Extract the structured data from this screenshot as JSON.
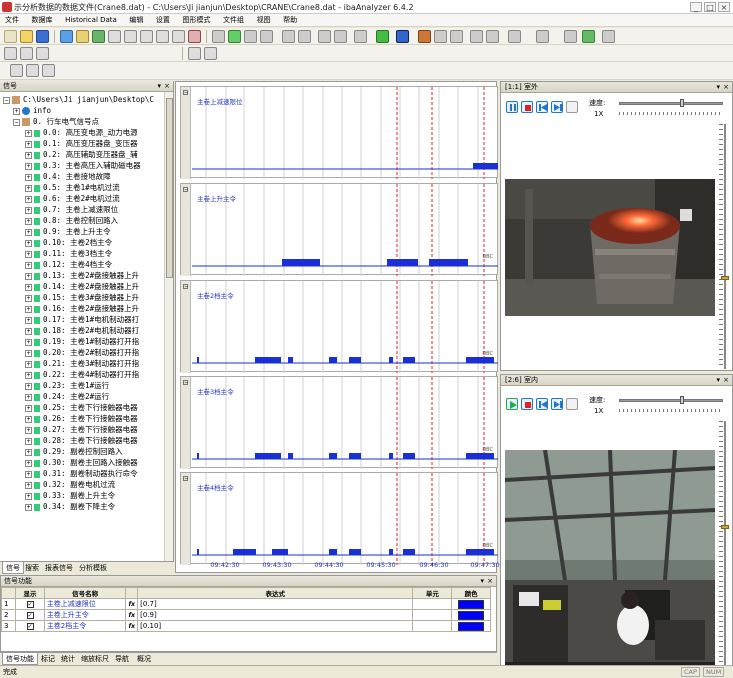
{
  "window": {
    "title": "示分析数据的数据文件(Crane8.dat) - C:\\Users\\Ji jianjun\\Desktop\\CRANE\\Crane8.dat - ibaAnalyzer 6.4.2"
  },
  "menu": [
    "文件",
    "数据库",
    "Historical Data",
    "编辑",
    "设置",
    "图形模式",
    "文件组",
    "视图",
    "帮助"
  ],
  "signal_panel": {
    "header": "信号",
    "root": "C:\\Users\\Ji jianjun\\Desktop\\C",
    "info": "info",
    "group": "0. 行车电气信号点",
    "signals": [
      "0.0: 高压变电源_动力电源",
      "0.1: 高压变压器盘_变压器",
      "0.2: 高压辅助变压器盘_辅",
      "0.3: 主卷高压入辅助磁电器",
      "0.4: 主卷接地故障",
      "0.5: 主卷1#电机过流",
      "0.6: 主卷2#电机过流",
      "0.7: 主卷上减速限位",
      "0.8: 主卷控制回路入",
      "0.9: 主卷上升主令",
      "0.10: 主卷2档主令",
      "0.11: 主卷3档主令",
      "0.12: 主卷4档主令",
      "0.13: 主卷2#盘接触器上升",
      "0.14: 主卷2#盘接触器上升",
      "0.15: 主卷3#盘接触器上升",
      "0.16: 主卷2#盘接触器上升",
      "0.17: 主卷1#电机制动器打",
      "0.18: 主卷2#电机制动器打",
      "0.19: 主卷1#制动器打开指",
      "0.20: 主卷2#制动器打开指",
      "0.21: 主卷3#制动器打开指",
      "0.22: 主卷4#制动器打开指",
      "0.23: 主卷1#运行",
      "0.24: 主卷2#运行",
      "0.25: 主卷下行接触器电器",
      "0.26: 主卷下行接触器电器",
      "0.27: 主卷下行接触器电器",
      "0.28: 主卷下行接触器电器",
      "0.29: 副卷控制回路入",
      "0.30: 副卷主回路入接触器",
      "0.31: 副卷制动器执行命令",
      "0.32: 副卷电机过流",
      "0.33: 副卷上升主令",
      "0.34: 副卷下降主令"
    ],
    "tabs": [
      "信号",
      "搜索",
      "报表信号",
      "分析模板"
    ]
  },
  "graphs": [
    {
      "label": "主卷上减速限位",
      "unit": ""
    },
    {
      "label": "主卷上升主令",
      "unit": "DBC"
    },
    {
      "label": "主卷2档主令",
      "unit": "DBC"
    },
    {
      "label": "主卷3档主令",
      "unit": "DBC"
    },
    {
      "label": "主卷4档主令",
      "unit": "DBC"
    }
  ],
  "time_axis": [
    "09:42:30",
    "09:43:30",
    "09:44:30",
    "09:45:30",
    "09:46:30",
    "09:47:30"
  ],
  "video1": {
    "title": "[1:1] 室外",
    "speed_label": "速度:",
    "speed_value": "1X"
  },
  "video2": {
    "title": "[2:6] 室内",
    "speed_label": "速度:",
    "speed_value": "1X"
  },
  "func_panel": {
    "header": "信号功能",
    "columns": [
      "显示",
      "信号名称",
      "表达式",
      "单元",
      "颜色"
    ],
    "rows": [
      {
        "n": "1",
        "name": "主卷上减速限位",
        "expr": "[0.7]"
      },
      {
        "n": "2",
        "name": "主卷上升主令",
        "expr": "[0.9]"
      },
      {
        "n": "3",
        "name": "主卷2档主令",
        "expr": "[0.10]"
      }
    ],
    "fx": "fx",
    "color": "#0000ff"
  },
  "bottom_tabs": [
    "信号功能",
    "标记",
    "统计",
    "缩放标尺",
    "导航",
    "概况"
  ],
  "status": {
    "text": "完成",
    "caps": "CAP",
    "num": "NUM"
  }
}
